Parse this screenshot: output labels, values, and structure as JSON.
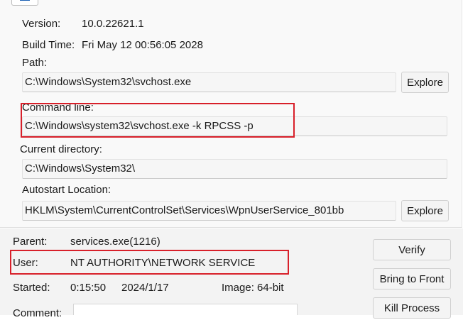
{
  "image_props": {
    "version_label": "Version:",
    "version_value": "10.0.22621.1",
    "build_label": "Build Time:",
    "build_value": "Fri May 12 00:56:05 2028",
    "path_label": "Path:",
    "path_value": "C:\\Windows\\System32\\svchost.exe",
    "explore_label": "Explore",
    "cmdline_label": "Command line:",
    "cmdline_value": "C:\\Windows\\system32\\svchost.exe -k RPCSS -p",
    "curdir_label": "Current directory:",
    "curdir_value": "C:\\Windows\\System32\\",
    "autostart_label": "Autostart Location:",
    "autostart_value": "HKLM\\System\\CurrentControlSet\\Services\\WpnUserService_801bb",
    "explore2_label": "Explore"
  },
  "process_info": {
    "parent_label": "Parent:",
    "parent_value": "services.exe(1216)",
    "user_label": "User:",
    "user_value": "NT AUTHORITY\\NETWORK SERVICE",
    "started_label": "Started:",
    "started_time": "0:15:50",
    "started_date": "2024/1/17",
    "image_label": "Image: 64-bit",
    "comment_label": "Comment:",
    "comment_value": ""
  },
  "buttons": {
    "verify": "Verify",
    "bring_to_front": "Bring to Front",
    "kill_process": "Kill Process"
  },
  "colors": {
    "highlight_box": "#d8202a",
    "icon_blue": "#1a5fb4"
  }
}
